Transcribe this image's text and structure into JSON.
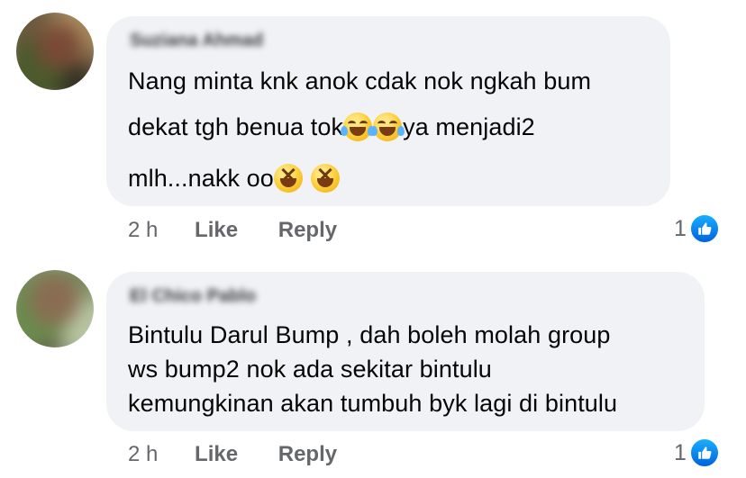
{
  "comments": [
    {
      "author": "Suziana Ahmad",
      "lines": [
        "Nang minta knk anok cdak nok ngkah bum",
        "dekat tgh benua tok",
        "ya menjadi2",
        "mlh...nakk oo"
      ],
      "emojis": [
        "tears-of-joy-emoji",
        "tears-of-joy-emoji",
        "grinning-squinting-emoji",
        "grinning-squinting-emoji"
      ],
      "time": "2 h",
      "like_label": "Like",
      "reply_label": "Reply",
      "reaction_count": "1",
      "reaction_icon": "like-thumb-icon"
    },
    {
      "author": "El Chico Pablo",
      "lines": [
        "Bintulu Darul Bump , dah boleh molah group",
        "ws bump2 nok ada sekitar bintulu",
        "kemungkinan akan tumbuh byk lagi di bintulu"
      ],
      "time": "2 h",
      "like_label": "Like",
      "reply_label": "Reply",
      "reaction_count": "1",
      "reaction_icon": "like-thumb-icon"
    }
  ],
  "colors": {
    "bubble_bg": "#f0f2f5",
    "meta_text": "#65676b",
    "like_blue": "#1877f2"
  }
}
